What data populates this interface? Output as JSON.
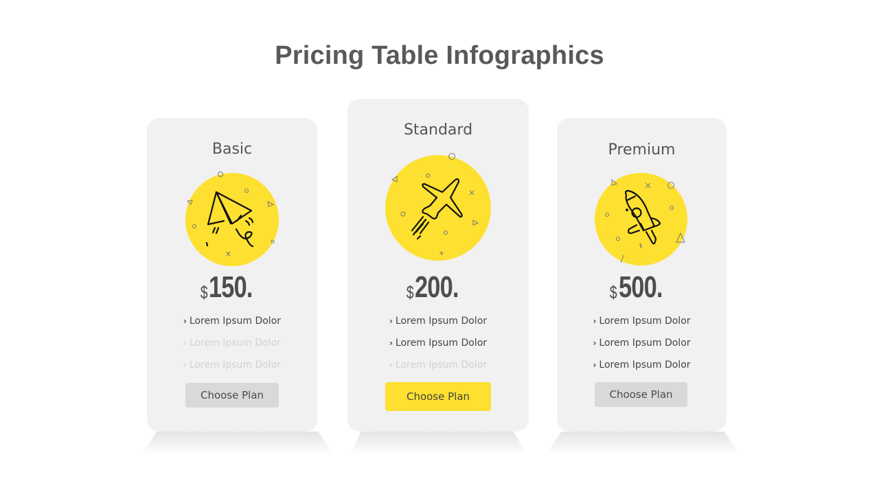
{
  "title": "Pricing Table Infographics",
  "colors": {
    "accent": "#fde030",
    "card_bg": "#f1f1f1",
    "button_gray": "#d9d9d9",
    "text_dark": "#4d4d4d",
    "text_dim": "#d2d2d2"
  },
  "plans": [
    {
      "name": "Basic",
      "icon": "paper-plane-icon",
      "currency": "$",
      "price": "150.",
      "features": [
        {
          "label": "Lorem Ipsum Dolor",
          "included": true
        },
        {
          "label": "Lorem Ipsum Dolor",
          "included": false
        },
        {
          "label": "Lorem Ipsum Dolor",
          "included": false
        }
      ],
      "button_label": "Choose Plan",
      "highlighted": false
    },
    {
      "name": "Standard",
      "icon": "airplane-icon",
      "currency": "$",
      "price": "200.",
      "features": [
        {
          "label": "Lorem Ipsum Dolor",
          "included": true
        },
        {
          "label": "Lorem Ipsum Dolor",
          "included": true
        },
        {
          "label": "Lorem Ipsum Dolor",
          "included": false
        }
      ],
      "button_label": "Choose Plan",
      "highlighted": true
    },
    {
      "name": "Premium",
      "icon": "rocket-icon",
      "currency": "$",
      "price": "500.",
      "features": [
        {
          "label": "Lorem Ipsum Dolor",
          "included": true
        },
        {
          "label": "Lorem Ipsum Dolor",
          "included": true
        },
        {
          "label": "Lorem Ipsum Dolor",
          "included": true
        }
      ],
      "button_label": "Choose Plan",
      "highlighted": false
    }
  ],
  "bullet_glyph": "›"
}
